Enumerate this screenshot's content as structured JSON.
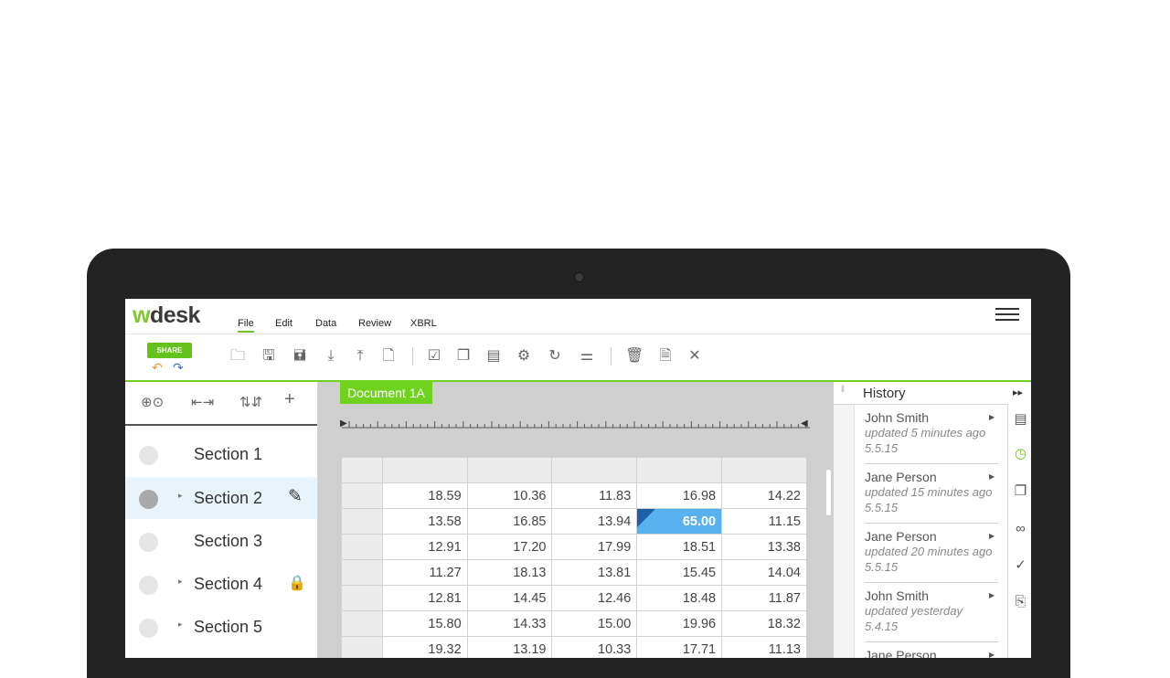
{
  "app": {
    "logo": "desk",
    "logo_prefix": "w"
  },
  "menu": {
    "items": [
      "File",
      "Edit",
      "Data",
      "Review",
      "XBRL"
    ],
    "active": "File"
  },
  "toolbar": {
    "share_label": "SHARE",
    "undo_glyph": "↶",
    "redo_glyph": "↷",
    "icons": [
      "folder-open-icon",
      "save-icon",
      "save-as-icon",
      "import-icon",
      "export-icon",
      "new-doc-icon",
      "check-icon",
      "copy-icon",
      "paste-icon",
      "doc-settings-icon",
      "doc-refresh-icon",
      "adjust-icon",
      "trash-icon",
      "doc-lock-icon",
      "close-icon"
    ]
  },
  "left_tools": [
    "+",
    "⊕",
    "⇆",
    "⇅"
  ],
  "sections": [
    {
      "label": "Section 1",
      "caret": "",
      "end_icon": ""
    },
    {
      "label": "Section 2",
      "caret": "▸",
      "end_icon": "✎"
    },
    {
      "label": "Section 3",
      "caret": "",
      "end_icon": ""
    },
    {
      "label": "Section 4",
      "caret": "▸",
      "end_icon": "🔒"
    },
    {
      "label": "Section 5",
      "caret": "▸",
      "end_icon": ""
    }
  ],
  "document": {
    "tab": "Document 1A",
    "rows": [
      [
        "18.59",
        "10.36",
        "11.83",
        "16.98",
        "14.22"
      ],
      [
        "13.58",
        "16.85",
        "13.94",
        "65.00",
        "11.15"
      ],
      [
        "12.91",
        "17.20",
        "17.99",
        "18.51",
        "13.38"
      ],
      [
        "11.27",
        "18.13",
        "13.81",
        "15.45",
        "14.04"
      ],
      [
        "12.81",
        "14.45",
        "12.46",
        "18.48",
        "11.87"
      ],
      [
        "15.80",
        "14.33",
        "15.00",
        "19.96",
        "18.32"
      ],
      [
        "19.32",
        "13.19",
        "10.33",
        "17.71",
        "11.13"
      ]
    ],
    "selected_cell": {
      "row": 1,
      "col": 3
    }
  },
  "history": {
    "title": "History",
    "collapse_glyph": "▸▸",
    "entries": [
      {
        "name": "John Smith",
        "time": "updated 5 minutes ago",
        "version": "5.5.15"
      },
      {
        "name": "Jane Person",
        "time": "updated 15 minutes ago",
        "version": "5.5.15"
      },
      {
        "name": "Jane Person",
        "time": "updated 20 minutes ago",
        "version": "5.5.15"
      },
      {
        "name": "John Smith",
        "time": "updated yesterday",
        "version": "5.4.15"
      },
      {
        "name": "Jane Person",
        "time": "",
        "version": ""
      }
    ]
  },
  "side_icons": [
    "inbox-icon",
    "history-icon",
    "documents-icon",
    "link-icon",
    "check-circle-icon",
    "attachment-icon"
  ]
}
